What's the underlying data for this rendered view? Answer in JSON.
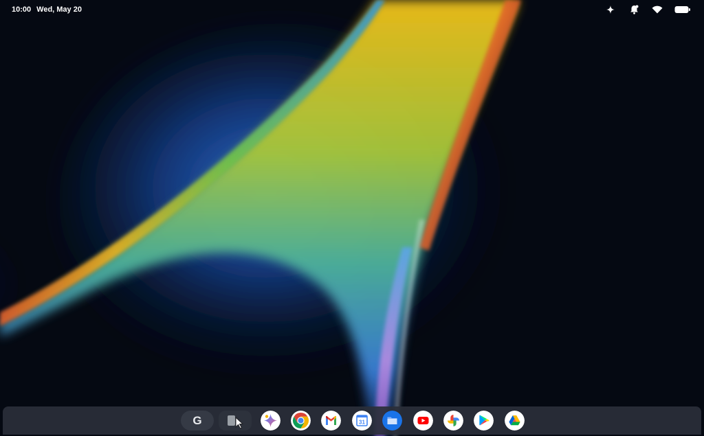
{
  "status_bar": {
    "time": "10:00",
    "date": "Wed, May 20",
    "icons": [
      "sparkle-icon",
      "notification-bell-icon",
      "wifi-icon",
      "battery-icon"
    ]
  },
  "shelf": {
    "launcher_label": "G",
    "apps": [
      {
        "name": "Gemini",
        "icon": "gemini-icon"
      },
      {
        "name": "Chrome",
        "icon": "chrome-icon"
      },
      {
        "name": "Gmail",
        "icon": "gmail-icon"
      },
      {
        "name": "Calendar",
        "icon": "calendar-icon",
        "label": "31"
      },
      {
        "name": "Files",
        "icon": "files-icon"
      },
      {
        "name": "YouTube",
        "icon": "youtube-icon"
      },
      {
        "name": "Photos",
        "icon": "photos-icon"
      },
      {
        "name": "Play Store",
        "icon": "play-store-icon"
      },
      {
        "name": "Drive",
        "icon": "drive-icon"
      }
    ]
  },
  "colors": {
    "background": "#050912",
    "shelf": "#2a2f3a",
    "text": "#ffffff"
  }
}
